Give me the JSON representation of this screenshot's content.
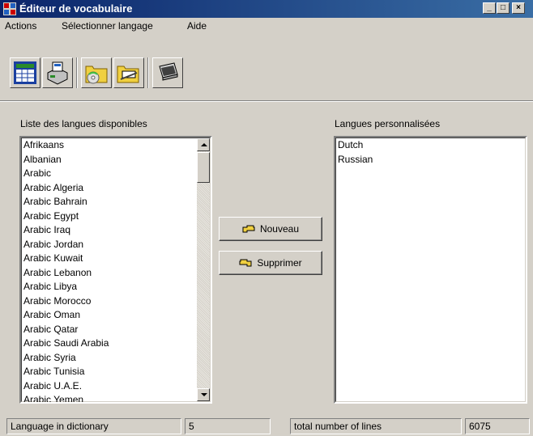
{
  "window": {
    "title": "Éditeur de vocabulaire",
    "min_glyph": "_",
    "max_glyph": "□",
    "close_glyph": "×"
  },
  "menu": [
    "Actions",
    "Sélectionner langage",
    "Aide"
  ],
  "toolbar": {
    "icons": [
      "grid-icon",
      "printer-icon",
      "folder-cd-icon",
      "open-folder-icon",
      "laptop-icon"
    ]
  },
  "available": {
    "label": "Liste des langues disponibles",
    "items": [
      "Afrikaans",
      "Albanian",
      "Arabic",
      "Arabic Algeria",
      "Arabic Bahrain",
      "Arabic Egypt",
      "Arabic Iraq",
      "Arabic Jordan",
      "Arabic Kuwait",
      "Arabic Lebanon",
      "Arabic Libya",
      "Arabic Morocco",
      "Arabic Oman",
      "Arabic Qatar",
      "Arabic Saudi Arabia",
      "Arabic Syria",
      "Arabic Tunisia",
      "Arabic U.A.E.",
      "Arabic Yemen"
    ]
  },
  "custom": {
    "label": "Langues personnalisées",
    "items": [
      "Dutch",
      "Russian"
    ]
  },
  "buttons": {
    "new_label": "Nouveau",
    "delete_label": "Supprimer"
  },
  "status": {
    "dict_label": "Language in dictionary",
    "dict_count": "5",
    "lines_label": "total number of lines",
    "lines_count": "6075"
  }
}
